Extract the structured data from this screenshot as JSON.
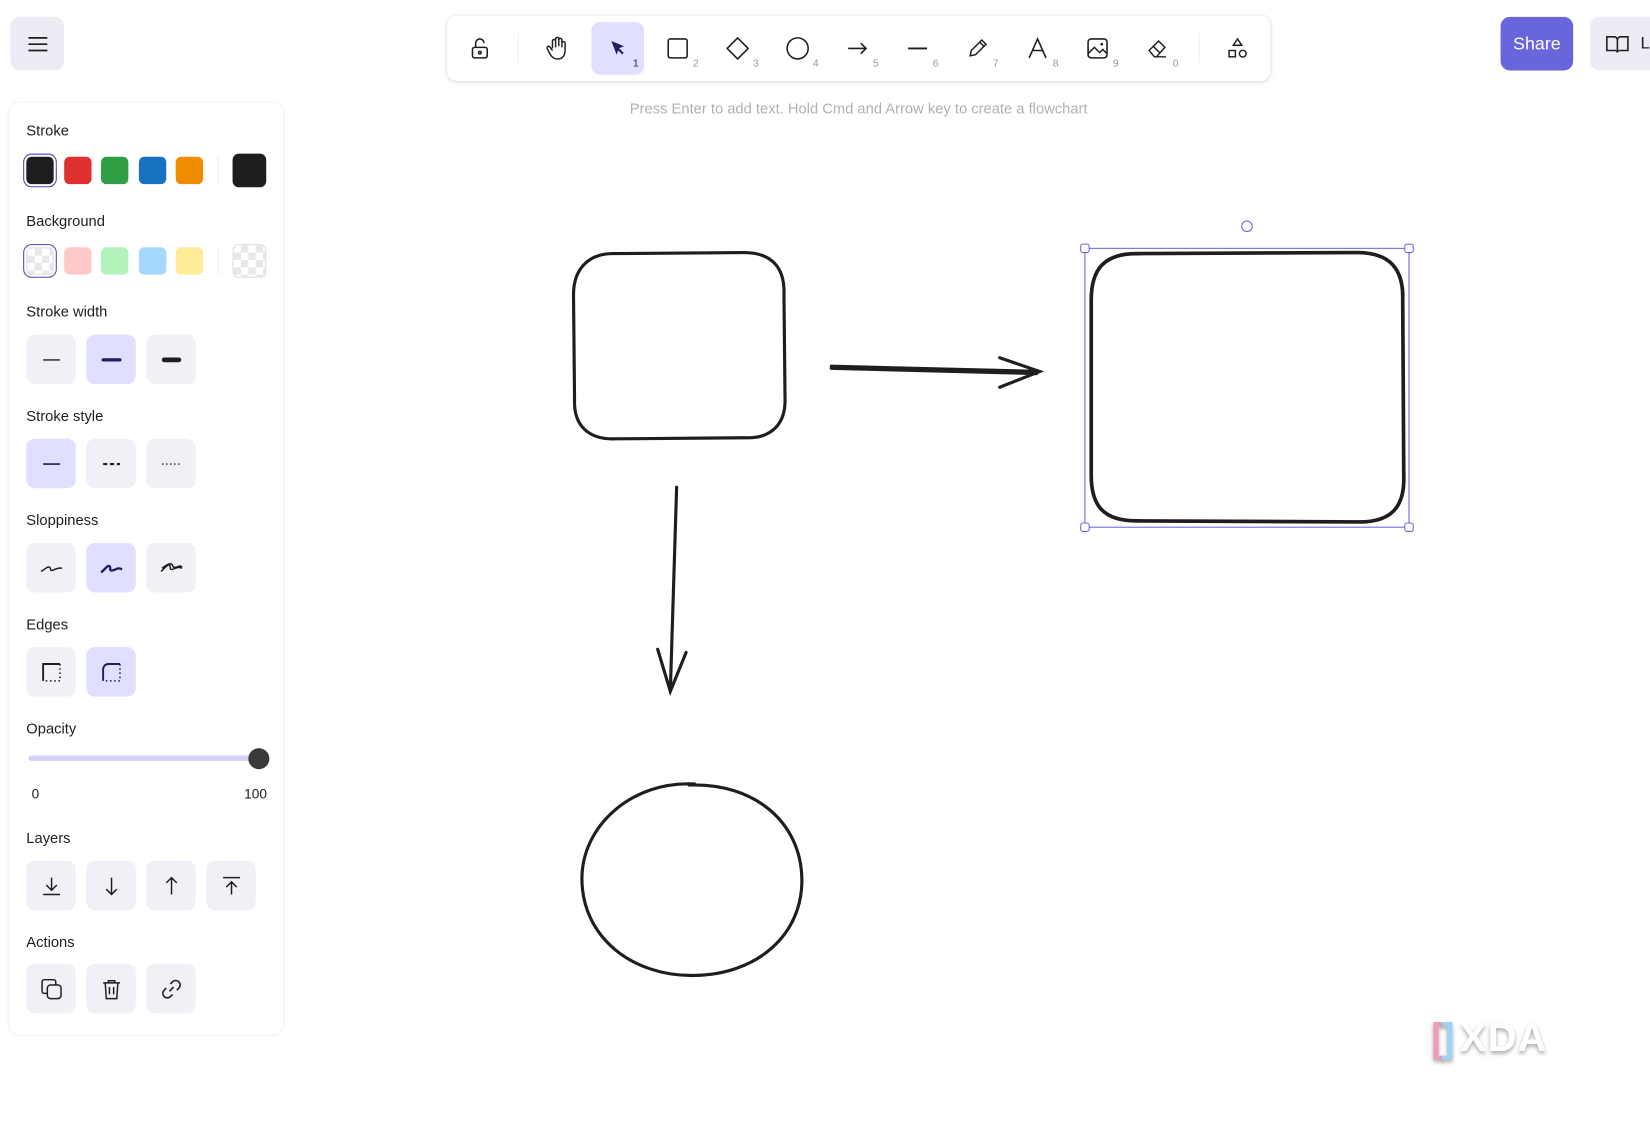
{
  "toolbar": {
    "tools": [
      {
        "name": "lock",
        "key": ""
      },
      {
        "name": "hand",
        "key": ""
      },
      {
        "name": "selection",
        "key": "1"
      },
      {
        "name": "rectangle",
        "key": "2"
      },
      {
        "name": "diamond",
        "key": "3"
      },
      {
        "name": "ellipse",
        "key": "4"
      },
      {
        "name": "arrow",
        "key": "5"
      },
      {
        "name": "line",
        "key": "6"
      },
      {
        "name": "draw",
        "key": "7"
      },
      {
        "name": "text",
        "key": "8"
      },
      {
        "name": "image",
        "key": "9"
      },
      {
        "name": "eraser",
        "key": "0"
      },
      {
        "name": "more-shapes",
        "key": ""
      }
    ],
    "active_tool": "selection"
  },
  "hint": "Press Enter to add text. Hold Cmd and Arrow key to create a flowchart",
  "share_label": "Share",
  "library_label": "L",
  "panel": {
    "stroke_label": "Stroke",
    "stroke_colors": [
      "#1e1e1e",
      "#e03131",
      "#2f9e44",
      "#1971c2",
      "#f08c00"
    ],
    "stroke_current": "#1e1e1e",
    "background_label": "Background",
    "background_colors": [
      "transparent",
      "#ffc9c9",
      "#b2f2bb",
      "#a5d8ff",
      "#ffec99"
    ],
    "background_current": "transparent",
    "stroke_width_label": "Stroke width",
    "stroke_width_selected": "bold",
    "stroke_style_label": "Stroke style",
    "stroke_style_selected": "solid",
    "sloppiness_label": "Sloppiness",
    "sloppiness_selected": "artist",
    "edges_label": "Edges",
    "edges_selected": "round",
    "opacity_label": "Opacity",
    "opacity_value": 100,
    "opacity_min": "0",
    "opacity_max": "100",
    "layers_label": "Layers",
    "actions_label": "Actions"
  },
  "watermark": "XDA",
  "accent": "#6965db"
}
